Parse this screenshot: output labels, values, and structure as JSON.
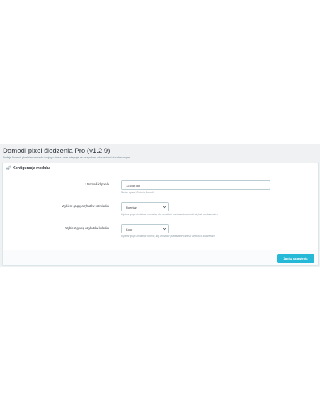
{
  "page": {
    "title": "Domodi pixel śledzenia Pro (v1.2.9)",
    "subtitle": "Dodaje Domodi pixel śledzenia do twojego sklepu oraz integruje ze wszystkimi zdarzeniami standardowymi"
  },
  "panel": {
    "heading": "Konfiguracja modułu",
    "heading_icon": "gear-icon",
    "fields": {
      "pixel_id": {
        "required_mark": "*",
        "label": "Domodi id pixela",
        "value": "123456789",
        "help": "Musisz wpisać ID pixela Domodi"
      },
      "size_group": {
        "label": "Wybierz grupę atrybutów rozmiarów",
        "selected": "Rozmiar",
        "help": "Wybierz grupę atrybutów rozmiarów, aby umożliwić przekazanie wartości atrybutu w zdarzeniach"
      },
      "color_group": {
        "label": "Wybierz grupę atrybutów kolorów",
        "selected": "Kolor",
        "help": "Wybierz grupę atrybutów kolorów, aby umożliwić przekazanie wartości atrybutu w zdarzeniach"
      }
    },
    "save_label": "Zapisz ustawienia"
  },
  "colors": {
    "accent": "#25b9d7",
    "band_background": "#eff1f2",
    "required": "#c05c67"
  }
}
